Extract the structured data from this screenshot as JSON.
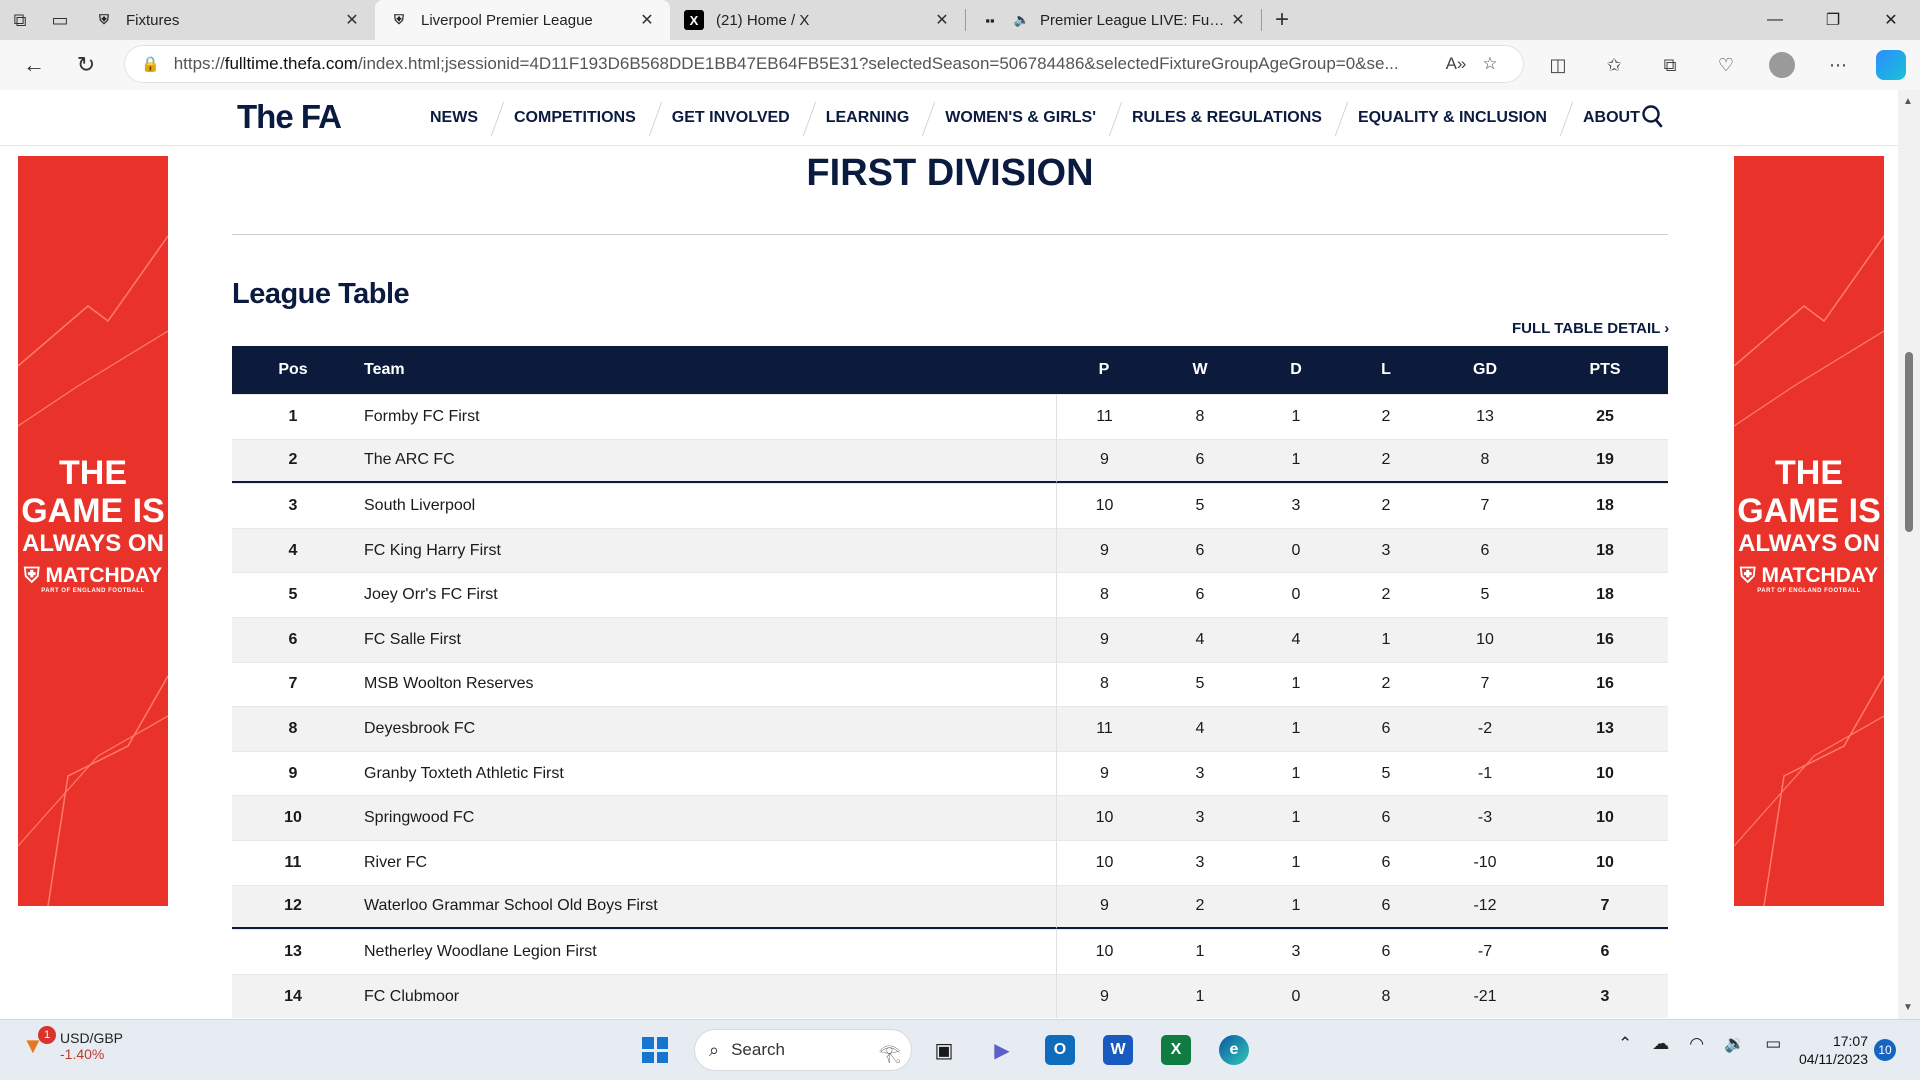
{
  "browser": {
    "tabs": [
      {
        "title": "Fixtures",
        "icon": "fa-crest-icon",
        "active": false
      },
      {
        "title": "Liverpool Premier League",
        "icon": "fa-crest-icon",
        "active": true
      },
      {
        "title": "(21) Home / X",
        "icon": "x-logo-icon",
        "active": false
      },
      {
        "title": "Premier League LIVE: Fulham",
        "icon": "news-icon",
        "active": false
      }
    ],
    "url_prefix": "https://",
    "url_domain": "fulltime.thefa.com",
    "url_rest": "/index.html;jsessionid=4D11F193D6B568DDE1BB47EB64FB5E31?selectedSeason=506784486&selectedFixtureGroupAgeGroup=0&se..."
  },
  "site": {
    "logo": "The FA",
    "nav": [
      "NEWS",
      "COMPETITIONS",
      "GET INVOLVED",
      "LEARNING",
      "WOMEN'S & GIRLS'",
      "RULES & REGULATIONS",
      "EQUALITY & INCLUSION",
      "ABOUT"
    ]
  },
  "ad": {
    "line1": "THE",
    "line2": "GAME IS",
    "line3": "ALWAYS ON",
    "line4": "MATCHDAY",
    "line5": "PART OF ENGLAND FOOTBALL"
  },
  "page": {
    "division_title": "FIRST DIVISION",
    "section_title": "League Table",
    "full_table_link": "FULL TABLE DETAIL"
  },
  "table": {
    "headers": [
      "Pos",
      "Team",
      "P",
      "W",
      "D",
      "L",
      "GD",
      "PTS"
    ],
    "rows": [
      [
        "1",
        "Formby FC First",
        "11",
        "8",
        "1",
        "2",
        "13",
        "25"
      ],
      [
        "2",
        "The ARC FC",
        "9",
        "6",
        "1",
        "2",
        "8",
        "19"
      ],
      [
        "3",
        "South Liverpool",
        "10",
        "5",
        "3",
        "2",
        "7",
        "18"
      ],
      [
        "4",
        "FC King Harry First",
        "9",
        "6",
        "0",
        "3",
        "6",
        "18"
      ],
      [
        "5",
        "Joey Orr's FC First",
        "8",
        "6",
        "0",
        "2",
        "5",
        "18"
      ],
      [
        "6",
        "FC Salle First",
        "9",
        "4",
        "4",
        "1",
        "10",
        "16"
      ],
      [
        "7",
        "MSB Woolton Reserves",
        "8",
        "5",
        "1",
        "2",
        "7",
        "16"
      ],
      [
        "8",
        "Deyesbrook FC",
        "11",
        "4",
        "1",
        "6",
        "-2",
        "13"
      ],
      [
        "9",
        "Granby Toxteth Athletic First",
        "9",
        "3",
        "1",
        "5",
        "-1",
        "10"
      ],
      [
        "10",
        "Springwood FC",
        "10",
        "3",
        "1",
        "6",
        "-3",
        "10"
      ],
      [
        "11",
        "River FC",
        "10",
        "3",
        "1",
        "6",
        "-10",
        "10"
      ],
      [
        "12",
        "Waterloo Grammar School Old Boys First",
        "9",
        "2",
        "1",
        "6",
        "-12",
        "7"
      ],
      [
        "13",
        "Netherley Woodlane Legion First",
        "10",
        "1",
        "3",
        "6",
        "-7",
        "6"
      ],
      [
        "14",
        "FC Clubmoor",
        "9",
        "1",
        "0",
        "8",
        "-21",
        "3"
      ]
    ],
    "cut_after_rows": [
      2,
      12
    ]
  },
  "taskbar": {
    "ticker_badge": "1",
    "ticker_symbol": "USD/GBP",
    "ticker_change": "-1.40%",
    "search_label": "Search",
    "time": "17:07",
    "date": "04/11/2023",
    "notifications": "10"
  },
  "colors": {
    "navy": "#0c1b3c",
    "ad_red": "#e8322a"
  }
}
